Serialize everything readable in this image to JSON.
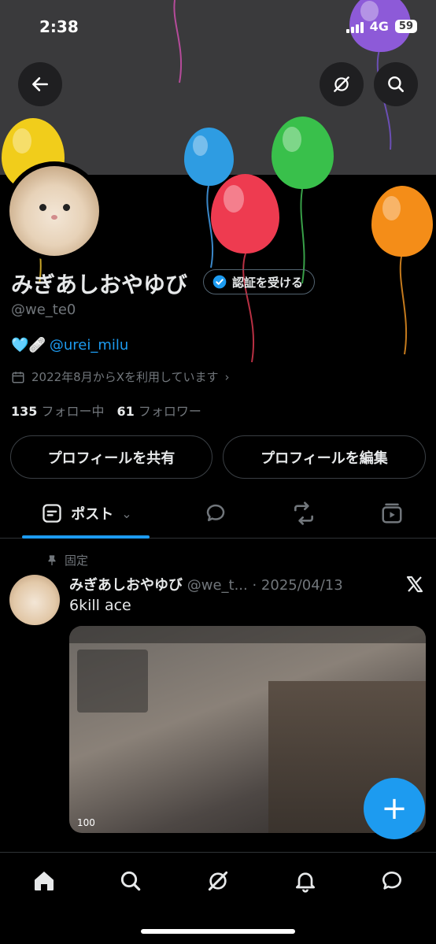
{
  "status_bar": {
    "time": "2:38",
    "network": "4G",
    "battery": "59"
  },
  "header": {
    "back_icon": "arrow-left-icon",
    "grok_icon": "grok-icon",
    "search_icon": "search-icon"
  },
  "profile": {
    "display_name": "みぎあしおやゆび",
    "verify_label": "認証を受ける",
    "handle": "@we_te0",
    "bio_emoji": "🩵🩹",
    "bio_mention": "@urei_milu",
    "joined": "2022年8月からXを利用しています",
    "following_count": "135",
    "following_label": "フォロー中",
    "followers_count": "61",
    "followers_label": "フォロワー",
    "share_button": "プロフィールを共有",
    "edit_button": "プロフィールを編集"
  },
  "tabs": {
    "posts_label": "ポスト"
  },
  "pinned_post": {
    "pinned_label": "固定",
    "author_name": "みぎあしおやゆび",
    "author_meta": "@we_t... · 2025/04/13",
    "text": "6kill ace",
    "media_hud": "100"
  },
  "fab": {
    "label": "+"
  },
  "colors": {
    "accent": "#1d9bf0",
    "background": "#000000",
    "banner": "#3a3a3c"
  }
}
